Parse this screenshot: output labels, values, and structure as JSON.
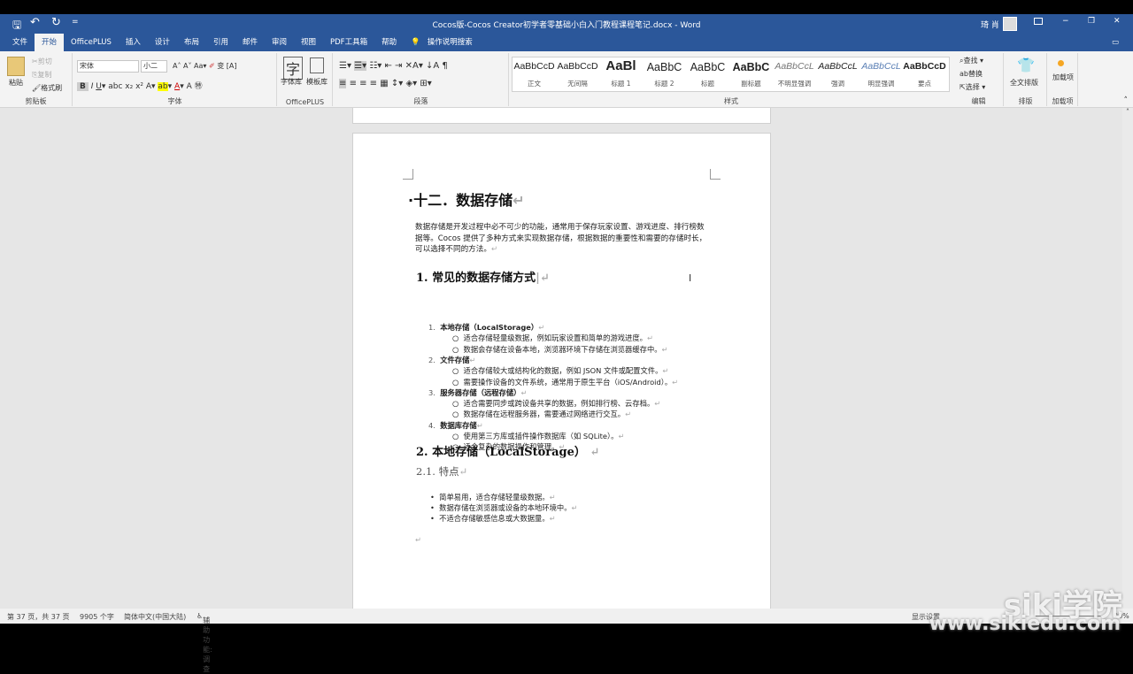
{
  "window": {
    "title": "Cocos版-Cocos Creator初学者零基础小白入门教程课程笔记.docx  -  Word",
    "user": "琦 肖",
    "min": "−",
    "max": "❐",
    "close": "✕"
  },
  "qat": {
    "save": "🖫",
    "undo": "↶",
    "redo": "↻",
    "more": "="
  },
  "tabs": [
    "文件",
    "开始",
    "OfficePLUS",
    "插入",
    "设计",
    "布局",
    "引用",
    "邮件",
    "审阅",
    "视图",
    "PDF工具箱",
    "帮助"
  ],
  "search_tip": "操作说明搜索",
  "ribbon": {
    "clipboard": {
      "label": "剪贴板",
      "paste": "粘贴",
      "cut": "剪切",
      "copy": "复制",
      "format_painter": "格式刷"
    },
    "font": {
      "label": "字体",
      "name": "宋体",
      "size": "小二"
    },
    "officeplus": {
      "label": "OfficePLUS",
      "fontlib": "字体库",
      "templates": "模板库"
    },
    "paragraph": {
      "label": "段落"
    },
    "styles": {
      "label": "样式",
      "items": [
        {
          "sample": "AaBbCcD",
          "name": "正文"
        },
        {
          "sample": "AaBbCcD",
          "name": "无间隔"
        },
        {
          "sample": "AaBl",
          "name": "标题 1"
        },
        {
          "sample": "AaBbC",
          "name": "标题 2"
        },
        {
          "sample": "AaBbC",
          "name": "标题"
        },
        {
          "sample": "AaBbC",
          "name": "副标题"
        },
        {
          "sample": "AaBbCcL",
          "name": "不明显强调"
        },
        {
          "sample": "AaBbCcL",
          "name": "强调"
        },
        {
          "sample": "AaBbCcL",
          "name": "明显强调"
        },
        {
          "sample": "AaBbCcD",
          "name": "要点"
        }
      ]
    },
    "editing": {
      "label": "编辑",
      "find": "查找",
      "replace": "替换",
      "select": "选择"
    },
    "layout": {
      "label": "排版",
      "full": "全文排版"
    },
    "addins": {
      "label": "加载项",
      "btn": "加载项"
    }
  },
  "doc": {
    "title": "·十二．数据存储",
    "intro": "数据存储是开发过程中必不可少的功能，通常用于保存玩家设置、游戏进度、排行榜数据等。Cocos 提供了多种方式来实现数据存储，根据数据的重要性和需要的存储时长，可以选择不同的方法。",
    "h_common": "1. 常见的数据存储方式",
    "list": [
      {
        "num": "1.",
        "title": "本地存储（LocalStorage）",
        "subs": [
          "适合存储轻量级数据，例如玩家设置和简单的游戏进度。",
          "数据会存储在设备本地，浏览器环境下存储在浏览器缓存中。"
        ]
      },
      {
        "num": "2.",
        "title": "文件存储",
        "subs": [
          "适合存储较大或结构化的数据，例如 JSON 文件或配置文件。",
          "需要操作设备的文件系统，通常用于原生平台（iOS/Android）。"
        ]
      },
      {
        "num": "3.",
        "title": "服务器存储（远程存储）",
        "subs": [
          "适合需要同步或跨设备共享的数据，例如排行榜、云存档。",
          "数据存储在远程服务器，需要通过网络进行交互。"
        ]
      },
      {
        "num": "4.",
        "title": "数据库存储",
        "subs": [
          "使用第三方库或插件操作数据库（如 SQLite）。",
          "适合复杂的数据操作和管理。"
        ]
      }
    ],
    "h_local": "2. 本地存储（LocalStorage）",
    "h_features": "2.1.  特点",
    "features": [
      "简单易用，适合存储轻量级数据。",
      "数据存储在浏览器或设备的本地环境中。",
      "不适合存储敏感信息或大数据量。"
    ]
  },
  "status": {
    "page": "第 37 页，共 37 页",
    "words": "9905 个字",
    "lang": "简体中文(中国大陆)",
    "access": "辅助功能: 调查",
    "display": "显示设置",
    "zoom": "90%"
  },
  "watermark": {
    "brand": "siki学院",
    "url": "www.sikiedu.com"
  }
}
